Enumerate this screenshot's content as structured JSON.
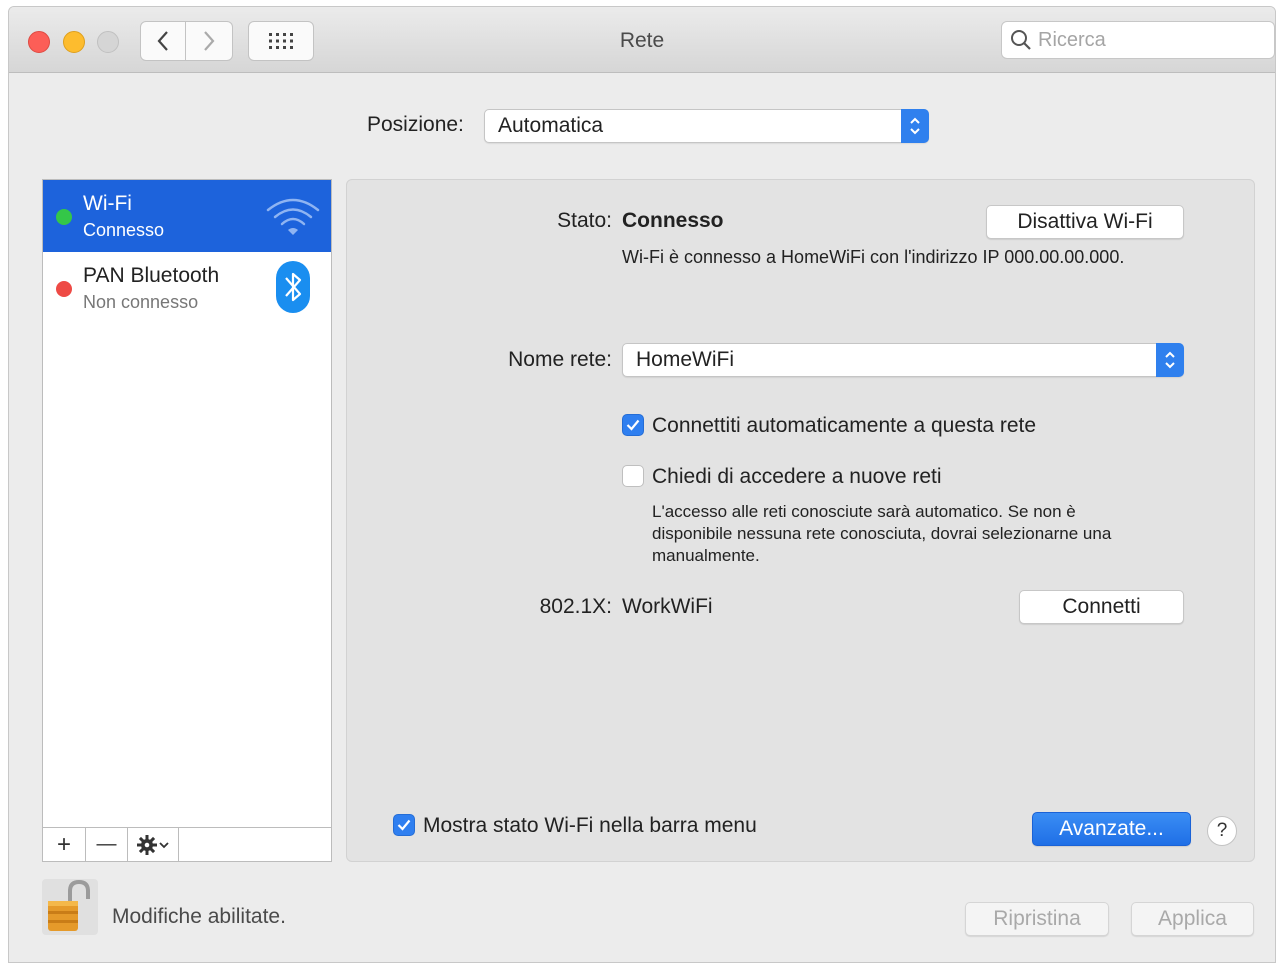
{
  "window": {
    "title": "Rete"
  },
  "toolbar": {
    "back_icon": "chevron-left-icon",
    "forward_icon": "chevron-right-icon",
    "grid_icon": "grid-icon"
  },
  "search": {
    "placeholder": "Ricerca"
  },
  "location": {
    "label": "Posizione:",
    "value": "Automatica"
  },
  "sidebar": {
    "items": [
      {
        "name": "Wi-Fi",
        "status": "Connesso",
        "status_color": "#34c748",
        "icon": "wifi-icon",
        "selected": true
      },
      {
        "name": "PAN Bluetooth",
        "status": "Non connesso",
        "status_color": "#ee4a45",
        "icon": "bluetooth-icon",
        "selected": false
      }
    ],
    "toolbar": {
      "add": "+",
      "remove": "—",
      "gear_icon": "gear-icon"
    }
  },
  "detail": {
    "status_label": "Stato:",
    "status_value": "Connesso",
    "status_desc": "Wi-Fi è connesso a HomeWiFi con l'indirizzo IP 000.00.00.000.",
    "turn_off_button": "Disattiva Wi-Fi",
    "network_label": "Nome rete:",
    "network_value": "HomeWiFi",
    "auto_join": {
      "label": "Connettiti automaticamente a questa rete",
      "checked": true
    },
    "ask_join": {
      "label": "Chiedi di accedere a nuove reti",
      "checked": false
    },
    "ask_desc_lines": [
      "L'accesso alle reti conosciute sarà automatico. Se non è",
      "disponibile nessuna rete conosciuta, dovrai selezionarne una",
      "manualmente."
    ],
    "dot1x_label": "802.1X:",
    "dot1x_value": "WorkWiFi",
    "connect_button": "Connetti",
    "show_status": {
      "label": "Mostra stato Wi-Fi nella barra menu",
      "checked": true
    },
    "advanced_button": "Avanzate...",
    "help": "?"
  },
  "footer": {
    "lock_text": "Modifiche abilitate.",
    "revert_button": "Ripristina",
    "apply_button": "Applica"
  },
  "colors": {
    "accent": "#2f80ee",
    "selection": "#1d63dc"
  }
}
